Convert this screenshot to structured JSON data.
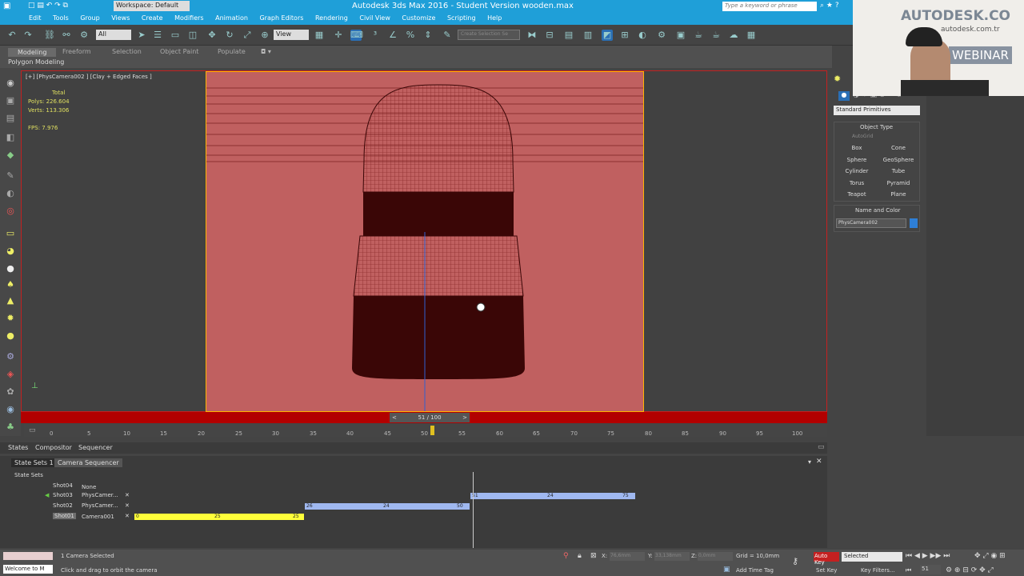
{
  "app": {
    "workspace_label": "Workspace: Default",
    "window_title": "Autodesk 3ds Max 2016 - Student Version   wooden.max",
    "search_placeholder": "Type a keyword or phrase"
  },
  "menu": [
    "Edit",
    "Tools",
    "Group",
    "Views",
    "Create",
    "Modifiers",
    "Animation",
    "Graph Editors",
    "Rendering",
    "Civil View",
    "Customize",
    "Scripting",
    "Help"
  ],
  "toolbar": {
    "filter_value": "All",
    "refcoord_value": "View",
    "named_selection_placeholder": "Create Selection Se"
  },
  "ribbon": {
    "tabs": [
      "Modeling",
      "Freeform",
      "Selection",
      "Object Paint",
      "Populate"
    ],
    "sublabel": "Polygon Modeling"
  },
  "viewport": {
    "label": "[+] [PhysCamera002 ] [Clay + Edged Faces ]",
    "stats": {
      "total_label": "Total",
      "polys_label": "Polys:",
      "polys_value": "226.604",
      "verts_label": "Verts:",
      "verts_value": "113.306",
      "fps_label": "FPS:",
      "fps_value": "7.976"
    }
  },
  "timeline": {
    "frame_label": "51 / 100",
    "ticks": [
      "0",
      "5",
      "10",
      "15",
      "20",
      "25",
      "30",
      "35",
      "40",
      "45",
      "50",
      "55",
      "60",
      "65",
      "70",
      "75",
      "80",
      "85",
      "90",
      "95",
      "100"
    ]
  },
  "command_panel": {
    "dropdown_value": "Standard Primitives",
    "object_type_title": "Object Type",
    "autogrid_label": "AutoGrid",
    "buttons": [
      "Box",
      "Cone",
      "Sphere",
      "GeoSphere",
      "Cylinder",
      "Tube",
      "Torus",
      "Pyramid",
      "Teapot",
      "Plane"
    ],
    "name_color_title": "Name and Color",
    "name_value": "PhysCamera002",
    "color": "#2e7fd6"
  },
  "sequencer": {
    "tabs": [
      "States",
      "Compositor",
      "Sequencer"
    ],
    "subtabs": [
      "State Sets 1",
      "Camera Sequencer"
    ],
    "root_label": "State Sets",
    "shots": [
      {
        "name": "Shot04",
        "camera": "None"
      },
      {
        "name": "Shot03",
        "camera": "PhysCamer..."
      },
      {
        "name": "Shot02",
        "camera": "PhysCamer..."
      },
      {
        "name": "Shot01",
        "camera": "Camera001"
      }
    ],
    "bars": [
      {
        "start": "51",
        "mid": "24",
        "end": "75",
        "color": "#9fb8f0"
      },
      {
        "start": "26",
        "mid": "24",
        "end": "50",
        "color": "#9fb8f0"
      },
      {
        "start": "0",
        "mid": "25",
        "end": "25",
        "color": "#ffff3a"
      }
    ]
  },
  "status": {
    "selection_text": "1 Camera Selected",
    "prompt_text": "Click and drag to orbit the camera",
    "welcome_text": "Welcome to M",
    "grid_text": "Grid = 10,0mm",
    "x_value": "76,6mm",
    "y_value": "33,138mm",
    "z_value": "0,0mm",
    "add_time_tag": "Add Time Tag",
    "autokey_label": "Auto Key",
    "setkey_label": "Set Key",
    "selected_value": "Selected",
    "keyfilters_label": "Key Filters...",
    "frame_value": "51"
  },
  "webcam": {
    "text1": "AUTODESK.CO",
    "text2": "autodesk.com.tr",
    "text3": "WEBINAR"
  }
}
